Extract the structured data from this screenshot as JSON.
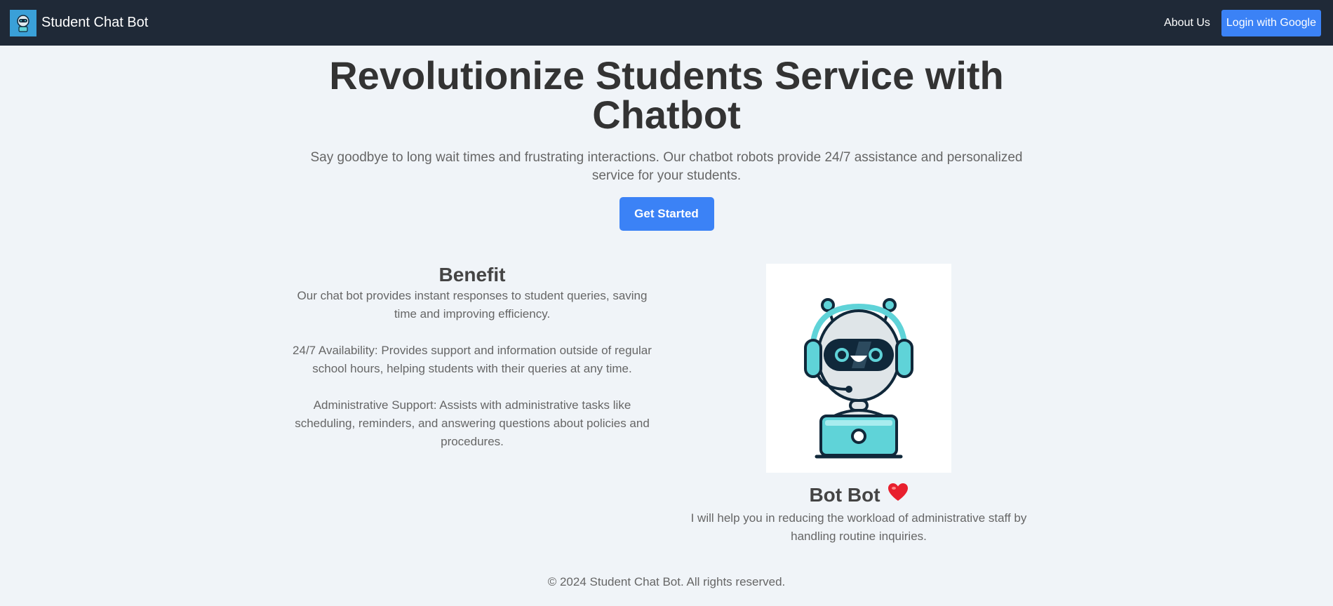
{
  "navbar": {
    "brand": "Student Chat Bot",
    "about_label": "About Us",
    "login_label": "Login with Google"
  },
  "hero": {
    "title": "Revolutionize Students Service with Chatbot",
    "subtitle": "Say goodbye to long wait times and frustrating interactions. Our chatbot robots provide 24/7 assistance and personalized service for your students.",
    "cta_label": "Get Started"
  },
  "benefit": {
    "heading": "Benefit",
    "paragraphs": [
      "Our chat bot provides instant responses to student queries, saving time and improving efficiency.",
      "24/7 Availability: Provides support and information outside of regular school hours, helping students with their queries at any time.",
      "Administrative Support: Assists with administrative tasks like scheduling, reminders, and answering questions about policies and procedures."
    ]
  },
  "bot": {
    "name": "Bot Bot",
    "description": "I will help you in reducing the workload of administrative staff by handling routine inquiries."
  },
  "footer": {
    "text": "© 2024 Student Chat Bot. All rights reserved."
  },
  "icons": {
    "logo": "robot-logo-icon",
    "heart": "heart-icon",
    "illustration": "robot-with-laptop-illustration"
  },
  "colors": {
    "navbar_bg": "#1f2937",
    "accent": "#3b82f6",
    "page_bg": "#f0f4f8",
    "robot_teal": "#5fd3d8"
  }
}
